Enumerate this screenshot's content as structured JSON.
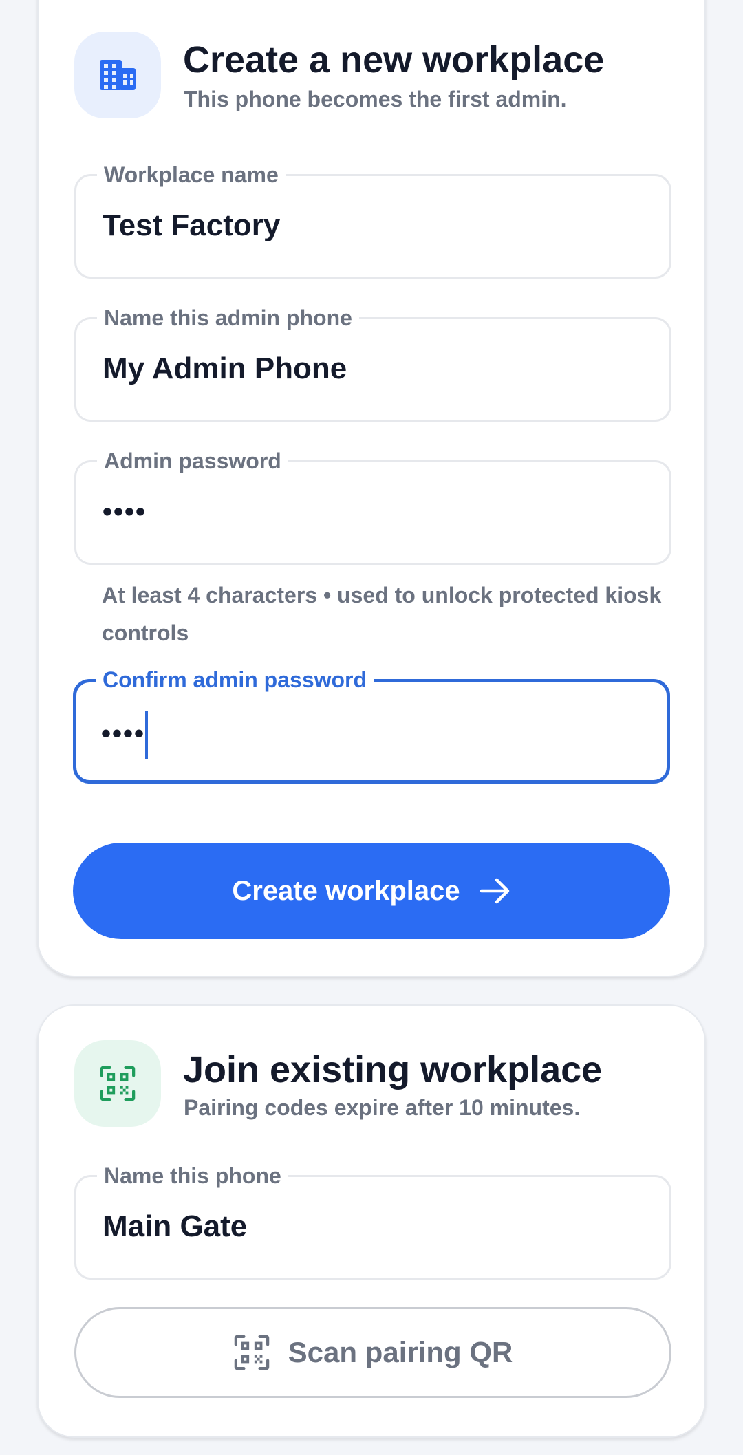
{
  "create": {
    "title": "Create a new workplace",
    "subtitle": "This phone becomes the first admin.",
    "icon": "building-icon",
    "fields": {
      "workplace_name": {
        "label": "Workplace name",
        "value": "Test Factory"
      },
      "admin_phone_name": {
        "label": "Name this admin phone",
        "value": "My Admin Phone"
      },
      "admin_password": {
        "label": "Admin password",
        "value": "••••"
      },
      "confirm_password": {
        "label": "Confirm admin password",
        "value": "••••"
      }
    },
    "helper": "At least 4 characters • used to unlock protected kiosk controls",
    "button": "Create workplace"
  },
  "join": {
    "title": "Join existing workplace",
    "subtitle": "Pairing codes expire after 10 minutes.",
    "icon": "qr-scan-icon",
    "fields": {
      "phone_name": {
        "label": "Name this phone",
        "value": "Main Gate"
      }
    },
    "button": "Scan pairing QR"
  },
  "colors": {
    "accent": "#2b6cf3",
    "focus": "#2f6ad9",
    "join_icon": "#1f9d5c",
    "create_icon_bg": "#e8effd",
    "join_icon_bg": "#e6f6ee"
  }
}
